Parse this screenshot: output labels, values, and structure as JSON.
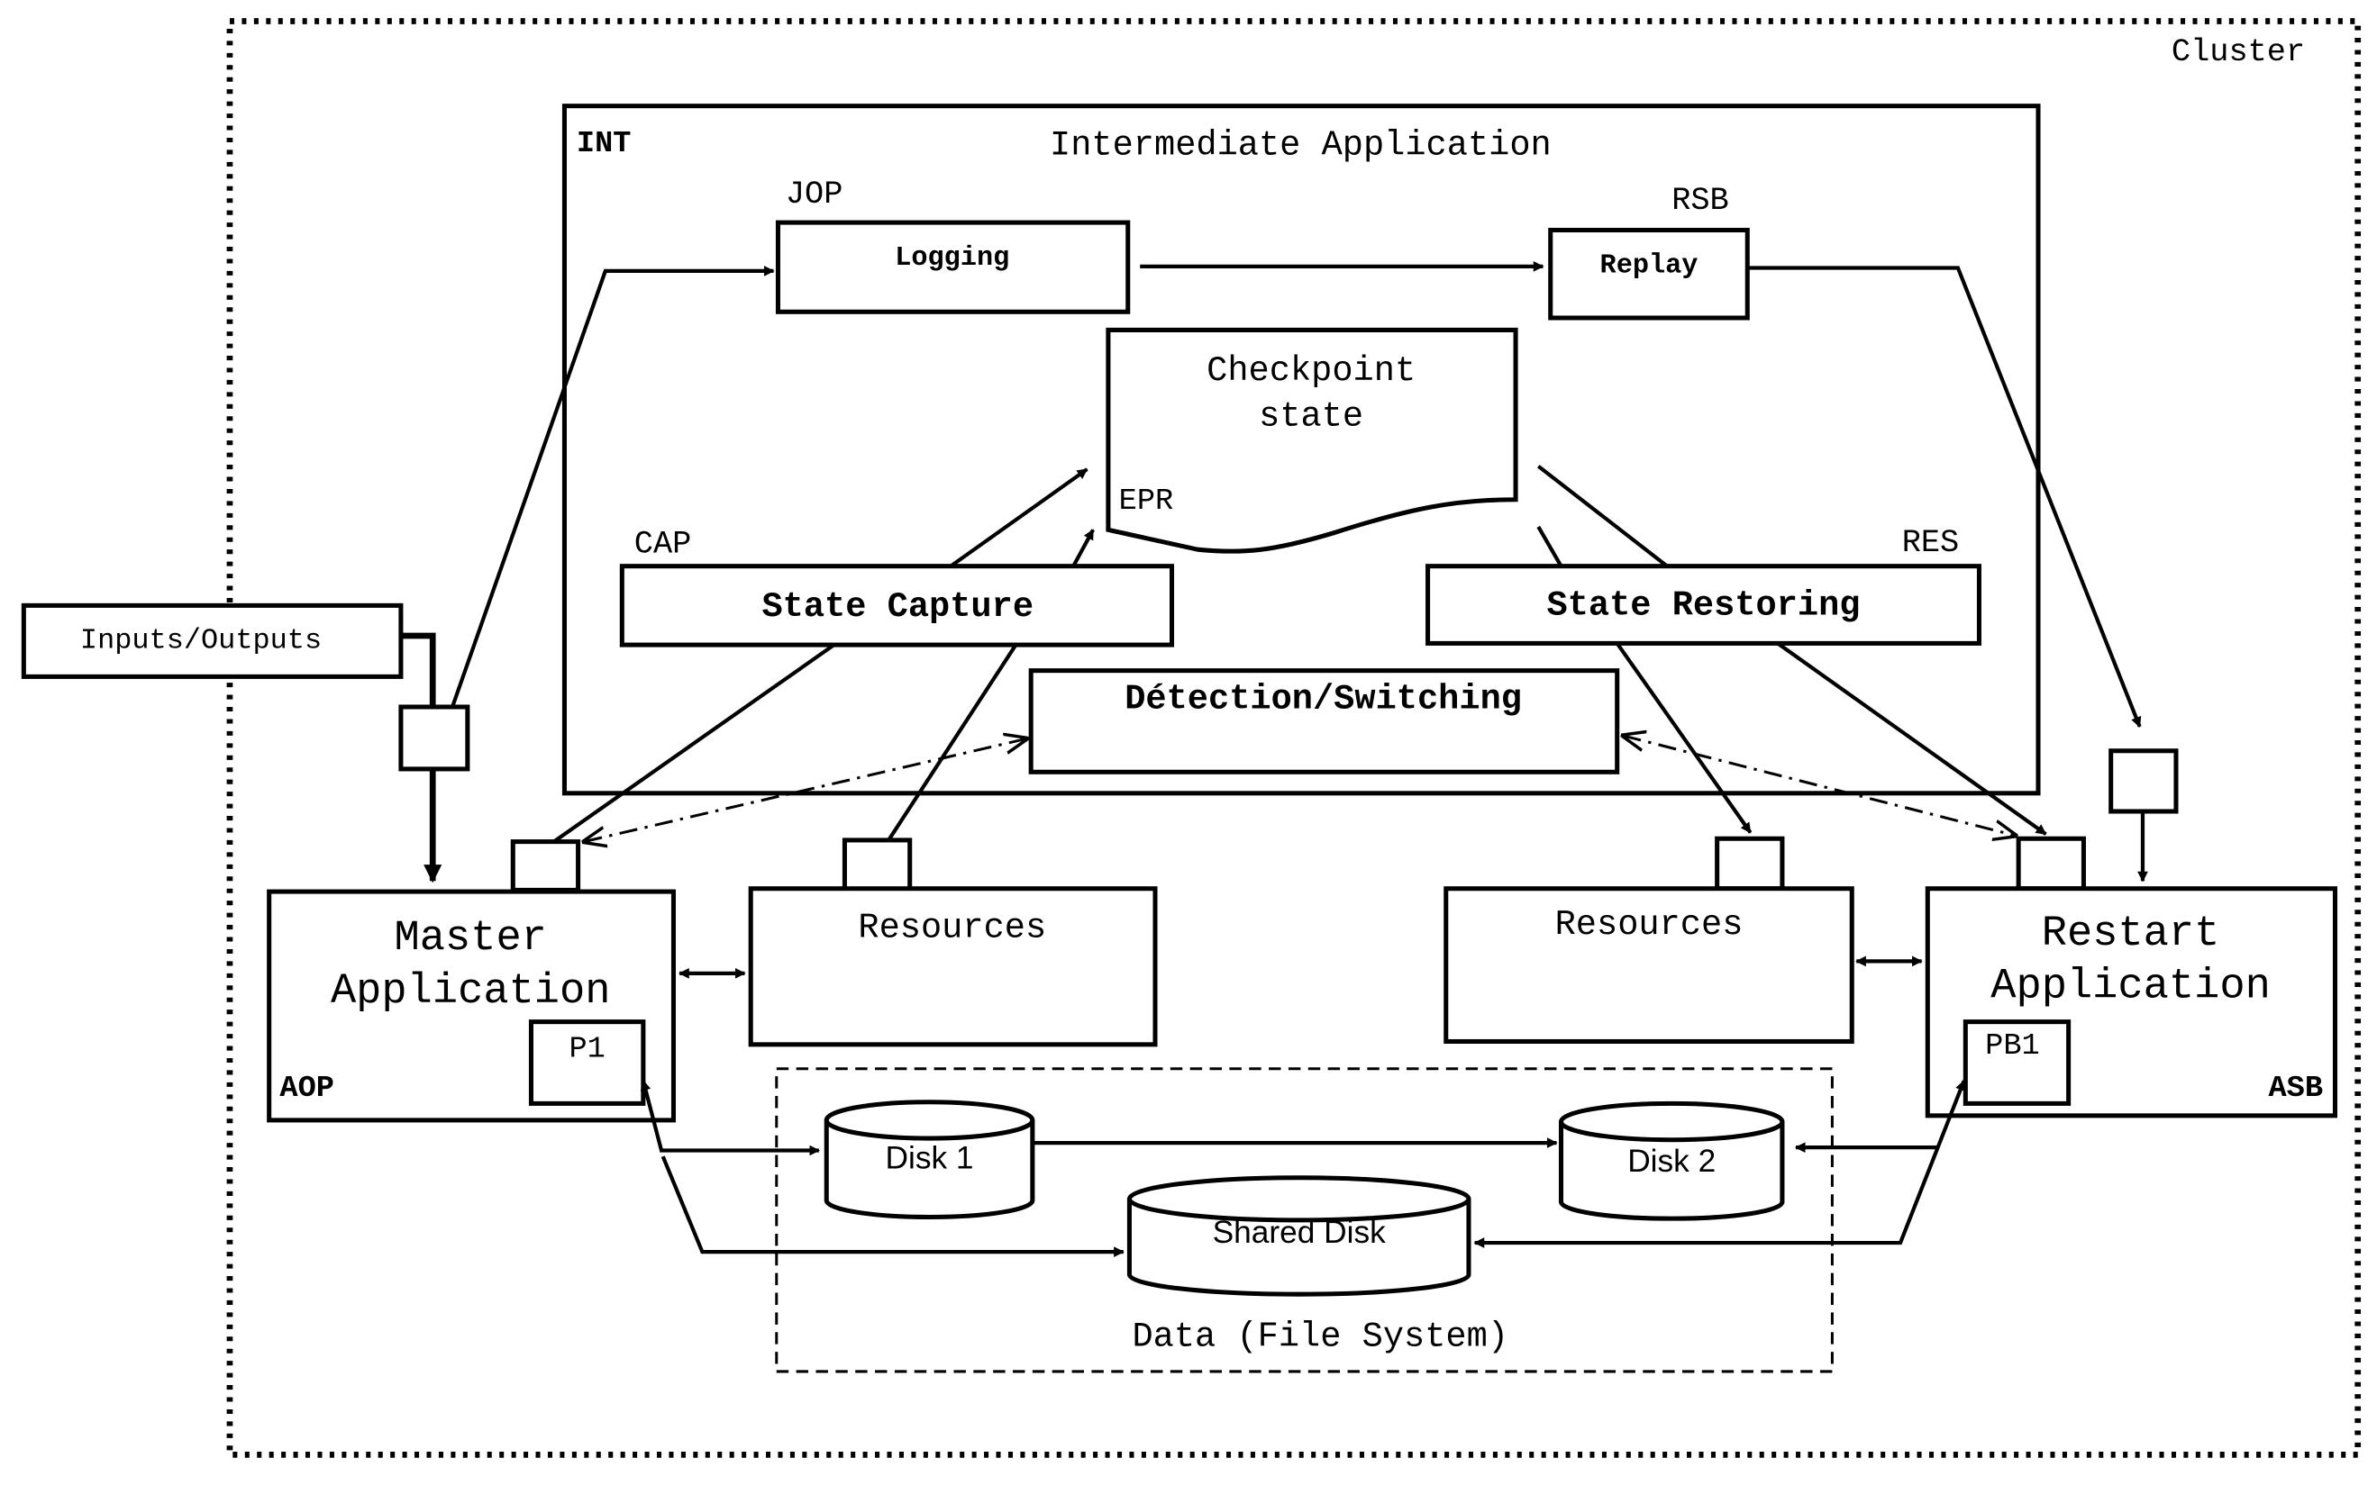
{
  "cluster": {
    "label": "Cluster"
  },
  "intermediate": {
    "tag": "INT",
    "title": "Intermediate Application",
    "logging": {
      "tag": "JOP",
      "label": "Logging"
    },
    "replay": {
      "tag": "RSB",
      "label": "Replay"
    },
    "checkpoint": {
      "tag": "EPR",
      "line1": "Checkpoint",
      "line2": "state"
    },
    "capture": {
      "tag": "CAP",
      "label": "State Capture"
    },
    "restoring": {
      "tag": "RES",
      "label": "State Restoring"
    },
    "detection": {
      "label": "Détection/Switching"
    }
  },
  "io": {
    "label": "Inputs/Outputs"
  },
  "master": {
    "line1": "Master",
    "line2": "Application",
    "tag": "AOP",
    "process": "P1"
  },
  "restart": {
    "line1": "Restart",
    "line2": "Application",
    "tag": "ASB",
    "process": "PB1"
  },
  "resources_left": {
    "label": "Resources"
  },
  "resources_right": {
    "label": "Resources"
  },
  "data": {
    "label": "Data (File System)",
    "disk1": "Disk 1",
    "disk2": "Disk 2",
    "shared": "Shared Disk"
  }
}
